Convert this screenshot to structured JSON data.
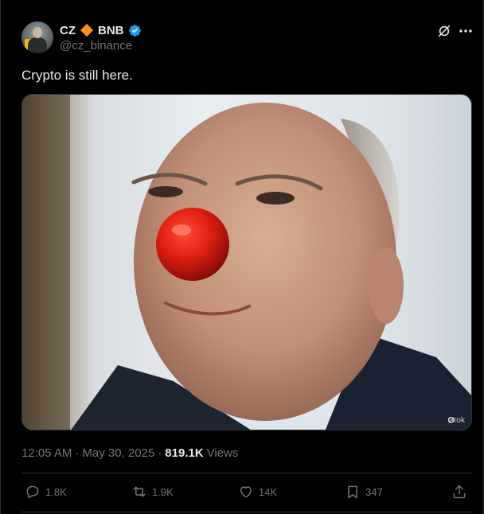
{
  "author": {
    "name_part1": "CZ",
    "name_part2": "BNB",
    "handle": "@cz_binance",
    "avatar": "profile-photo",
    "verified_color": "#1d9bf0",
    "bnb_color": "#f7931a"
  },
  "tweet": {
    "text": "Crypto is still here."
  },
  "media": {
    "watermark": "Grok",
    "description_icon": "clown-nose-photo"
  },
  "meta": {
    "time": "12:05 AM",
    "date": "May 30, 2025",
    "separator": "·",
    "views_count": "819.1K",
    "views_label": "Views"
  },
  "actions": {
    "replies": "1.8K",
    "reposts": "1.9K",
    "likes": "14K",
    "bookmarks": "347"
  },
  "icons": {
    "grok": "grok-icon",
    "more": "more-icon",
    "reply": "reply-icon",
    "repost": "repost-icon",
    "like": "heart-icon",
    "bookmark": "bookmark-icon",
    "share": "share-icon"
  },
  "colors": {
    "background": "#000000",
    "text_primary": "#e7e9ea",
    "text_secondary": "#71767b",
    "border": "#2f3336",
    "accent": "#1d9bf0"
  }
}
